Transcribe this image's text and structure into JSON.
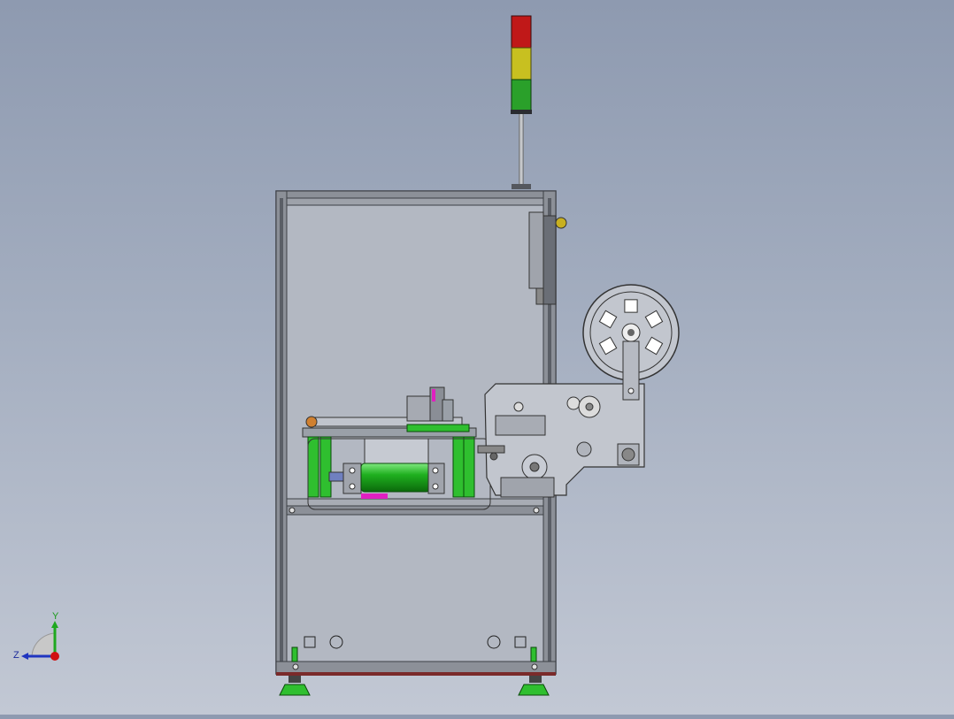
{
  "view": {
    "axis_y_label": "Y",
    "axis_z_label": "Z",
    "background_top": "#8e9ab0",
    "background_bottom": "#c2c8d4"
  },
  "stack_light": {
    "colors": [
      "#c01818",
      "#c8c020",
      "#2aa02a"
    ]
  },
  "colors": {
    "frame": "#8c9098",
    "frame_dark": "#4a4d54",
    "panel": "#b8bcc4",
    "green_part": "#2fbf2f",
    "magenta_part": "#e020c0",
    "orange_part": "#d08030"
  }
}
